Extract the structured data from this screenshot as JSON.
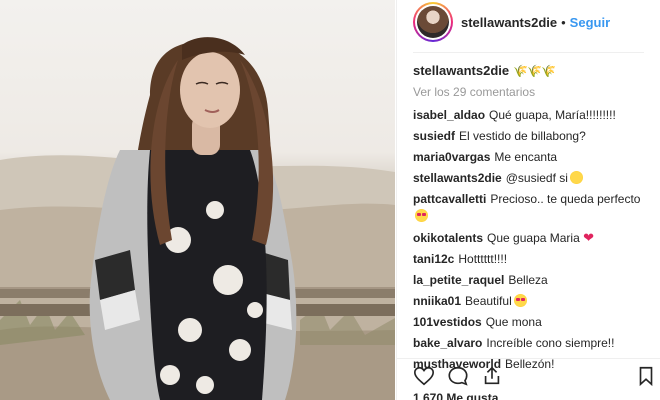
{
  "post": {
    "username": "stellawants2die",
    "follow_label": "Seguir",
    "separator": "•",
    "caption_emoji": "🌾🌾🌾",
    "view_comments": "Ver los 29 comentarios",
    "likes": "1.670 Me gusta"
  },
  "comments": [
    {
      "user": "isabel_aldao",
      "text": "Qué guapa, María!!!!!!!!!"
    },
    {
      "user": "susiedf",
      "text": "El vestido de billabong?"
    },
    {
      "user": "maria0vargas",
      "text": "Me encanta"
    },
    {
      "user": "stellawants2die",
      "text": "@susiedf si",
      "emoji": "smile"
    },
    {
      "user": "pattcavalletti",
      "text": "Precioso.. te queda perfecto",
      "emoji": "heart-eyes"
    },
    {
      "user": "okikotalents",
      "text": "Que guapa Maria",
      "emoji": "heart"
    },
    {
      "user": "tani12c",
      "text": "Hotttttt!!!!"
    },
    {
      "user": "la_petite_raquel",
      "text": "Belleza"
    },
    {
      "user": "nniika01",
      "text": "Beautiful",
      "emoji": "heart-eyes"
    },
    {
      "user": "101vestidos",
      "text": "Que mona"
    },
    {
      "user": "bake_alvaro",
      "text": "Increíble cono siempre!!"
    },
    {
      "user": "musthaveworld",
      "text": "Bellezón!"
    }
  ],
  "icons": {
    "like": "heart-icon",
    "comment": "comment-icon",
    "share": "share-icon",
    "save": "bookmark-icon"
  },
  "colors": {
    "follow": "#3897f0",
    "text": "#262626",
    "muted": "#999999",
    "heart": "#e0245e"
  }
}
